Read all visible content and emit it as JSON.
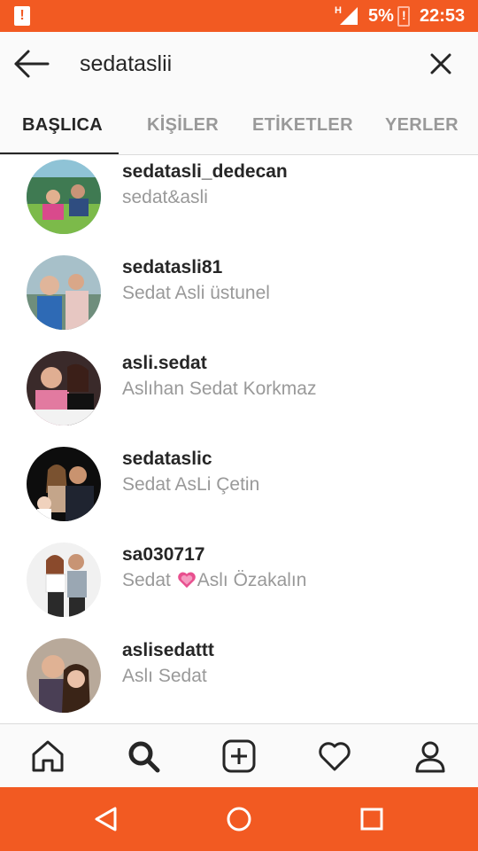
{
  "status_bar": {
    "network": "H",
    "battery_percent": "5%",
    "time": "22:53",
    "accent_color": "#f25a22"
  },
  "search": {
    "query": "sedataslii",
    "back_icon": "arrow-left-icon",
    "clear_icon": "close-icon"
  },
  "tabs": [
    {
      "label": "BAŞLICA",
      "active": true
    },
    {
      "label": "KİŞİLER",
      "active": false
    },
    {
      "label": "ETİKETLER",
      "active": false
    },
    {
      "label": "YERLER",
      "active": false
    }
  ],
  "results": [
    {
      "username": "sedatasli_dedecan",
      "full_name": "sedat&asli"
    },
    {
      "username": "sedatasli81",
      "full_name": "Sedat Asli üstunel"
    },
    {
      "username": "asli.sedat",
      "full_name": "Aslıhan Sedat Korkmaz"
    },
    {
      "username": "sedataslic",
      "full_name": "Sedat AsLi Çetin"
    },
    {
      "username": "sa030717",
      "full_name_before": "Sedat",
      "full_name_emoji": "heart-emoji",
      "full_name_after": "Aslı Özakalın"
    },
    {
      "username": "aslisedattt",
      "full_name": "Aslı Sedat"
    }
  ],
  "bottom_nav": [
    "home-icon",
    "search-icon",
    "add-post-icon",
    "heart-icon",
    "profile-icon"
  ],
  "android_nav": [
    "back-triangle-icon",
    "home-circle-icon",
    "recents-square-icon"
  ]
}
